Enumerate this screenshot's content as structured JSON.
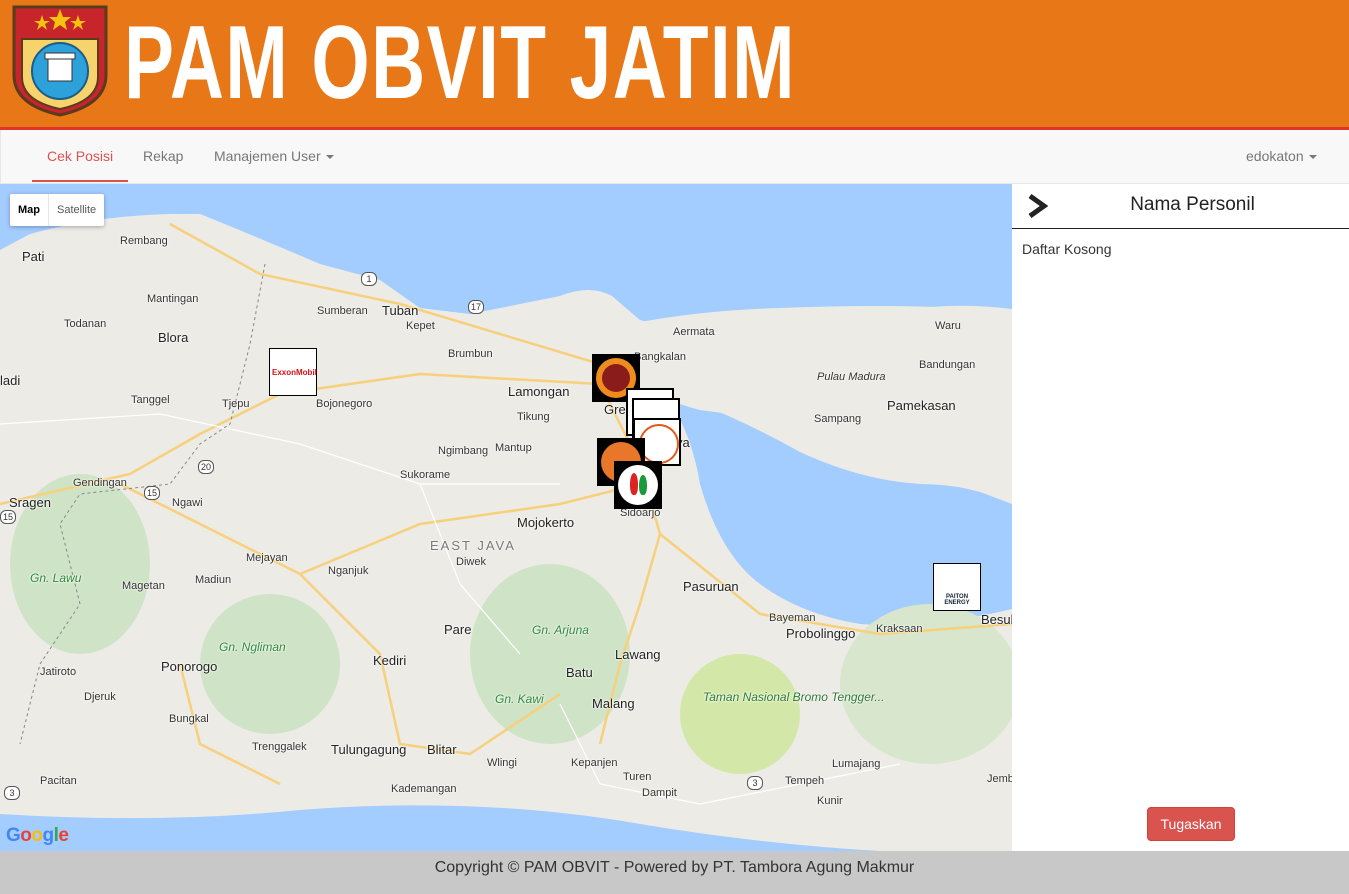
{
  "header": {
    "title": "PAM OBVIT JATIM",
    "emblem_icon": "police-emblem-icon"
  },
  "nav": {
    "items": [
      {
        "label": "Cek Posisi",
        "active": true
      },
      {
        "label": "Rekap",
        "active": false
      },
      {
        "label": "Manajemen User",
        "dropdown": true
      }
    ],
    "user": "edokaton"
  },
  "map": {
    "type_control": {
      "map": "Map",
      "satellite": "Satellite"
    },
    "selected_type": "Map",
    "places": {
      "rembang": "Rembang",
      "pati": "Pati",
      "mantingan": "Mantingan",
      "sumberan": "Sumberan",
      "tuban": "Tuban",
      "kepet": "Kepet",
      "todanan": "Todanan",
      "blora": "Blora",
      "ladi": "ladi",
      "brumbun": "Brumbun",
      "tanggel": "Tanggel",
      "tjepu": "Tjepu",
      "bojonegoro": "Bojonegoro",
      "lamongan": "Lamongan",
      "tikung": "Tikung",
      "ngimbang": "Ngimbang",
      "mantup": "Mantup",
      "sukorame": "Sukorame",
      "gendingan": "Gendingan",
      "sragen": "Sragen",
      "ngawi": "Ngawi",
      "mojokerto": "Mojokerto",
      "sidoarjo": "Sidoarjo",
      "east_java": "EAST JAVA",
      "gn_lawu": "Gn. Lawu",
      "magetan": "Magetan",
      "madiun": "Madiun",
      "mejayan": "Mejayan",
      "nganjuk": "Nganjuk",
      "diwek": "Diwek",
      "pasuruan": "Pasuruan",
      "bayeman": "Bayeman",
      "probolinggo": "Probolinggo",
      "kraksaan": "Kraksaan",
      "besuki": "Besul",
      "pare": "Pare",
      "gn_arjuna": "Gn. Arjuna",
      "gn_ngliman": "Gn. Ngliman",
      "ponorogo": "Ponorogo",
      "kediri": "Kediri",
      "lawang": "Lawang",
      "batu": "Batu",
      "jatiroto": "Jatiroto",
      "djeruk": "Djeruk",
      "gn_kawi": "Gn. Kawi",
      "malang": "Malang",
      "taman": "Taman Nasional Bromo Tengger...",
      "bungkal": "Bungkal",
      "trenggalek": "Trenggalek",
      "tulungagung": "Tulungagung",
      "blitar": "Blitar",
      "wlingi": "Wlingi",
      "kepanjen": "Kepanjen",
      "turen": "Turen",
      "lumajang": "Lumajang",
      "tempeh": "Tempeh",
      "pacitan": "Pacitan",
      "kademangan": "Kademangan",
      "dampit": "Dampit",
      "kunir": "Kunir",
      "jember": "Jemb",
      "aermata": "Aermata",
      "bangkalan": "Bangkalan",
      "waru": "Waru",
      "bandungan": "Bandungan",
      "pulau_madura": "Pulau Madura",
      "pamekasan": "Pamekasan",
      "sampang": "Sampang",
      "gresik": "Gre",
      "surabaya": "ya"
    },
    "road_shields": [
      "1",
      "17",
      "20",
      "15",
      "15",
      "3",
      "3"
    ],
    "markers": [
      {
        "name": "ExxonMobil",
        "label": "ExxonMobil"
      },
      {
        "name": "smelting",
        "label": "PT. SMELTING"
      },
      {
        "name": "paiton-energy",
        "label": "PAITON ENERGY"
      }
    ],
    "attribution": "Google"
  },
  "panel": {
    "title": "Nama Personil",
    "empty_text": "Daftar Kosong",
    "assign_button": "Tugaskan"
  },
  "footer": {
    "text": "Copyright © PAM OBVIT - Powered by PT. Tambora Agung Makmur"
  },
  "colors": {
    "banner": "#e87817",
    "accent": "#d9534f",
    "sea": "#a3ccff",
    "land": "#ecebe6"
  }
}
